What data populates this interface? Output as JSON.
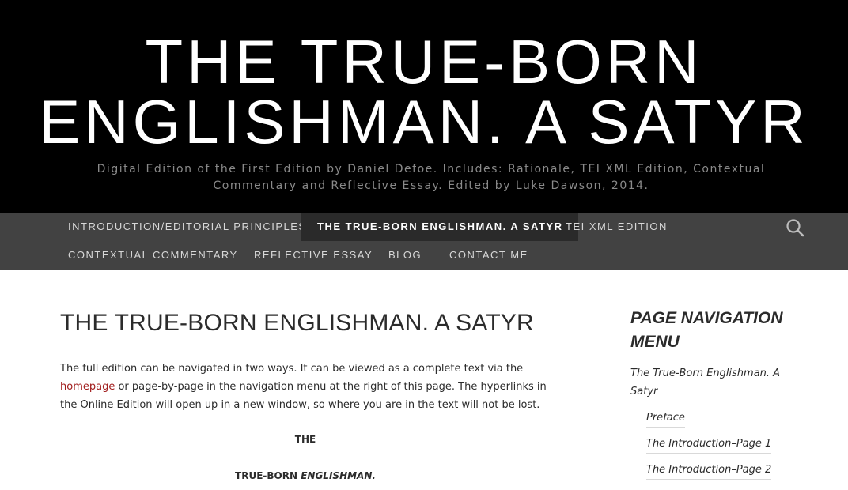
{
  "header": {
    "title_line1": "THE TRUE-BORN",
    "title_line2": "ENGLISHMAN. A SATYR",
    "description": "Digital Edition of the First Edition by Daniel Defoe. Includes: Rationale, TEI XML Edition, Contextual Commentary and Reflective Essay. Edited by Luke Dawson, 2014."
  },
  "nav": {
    "items": [
      "INTRODUCTION/EDITORIAL PRINCIPLES",
      "THE TRUE-BORN ENGLISHMAN. A SATYR",
      "TEI XML EDITION",
      "CONTEXTUAL COMMENTARY",
      "REFLECTIVE ESSAY",
      "BLOG",
      "CONTACT ME"
    ],
    "search_icon": "search-icon"
  },
  "main": {
    "title": "THE TRUE-BORN ENGLISHMAN. A SATYR",
    "intro_part1": "The full edition can be navigated in two ways. It can be viewed as a complete text via the",
    "intro_link": "homepage",
    "intro_part2": "or page-by-page in the navigation menu at the right of this page. The hyperlinks in the Online Edition will open up in a new window, so where you are in the text will not be lost.",
    "poem_line1": "THE",
    "poem_line2_a": "TRUE-BORN",
    "poem_line2_b": "ENGLISHMAN."
  },
  "sidebar": {
    "title": "PAGE NAVIGATION MENU",
    "links": [
      "The True-Born Englishman. A",
      "Satyr",
      "Preface",
      "The Introduction–Page 1",
      "The Introduction–Page 2"
    ]
  },
  "colors": {
    "header_bg": "#000000",
    "nav_bg": "#424242",
    "nav_active_bg": "#2a2a2a",
    "link": "#a11d1d"
  }
}
